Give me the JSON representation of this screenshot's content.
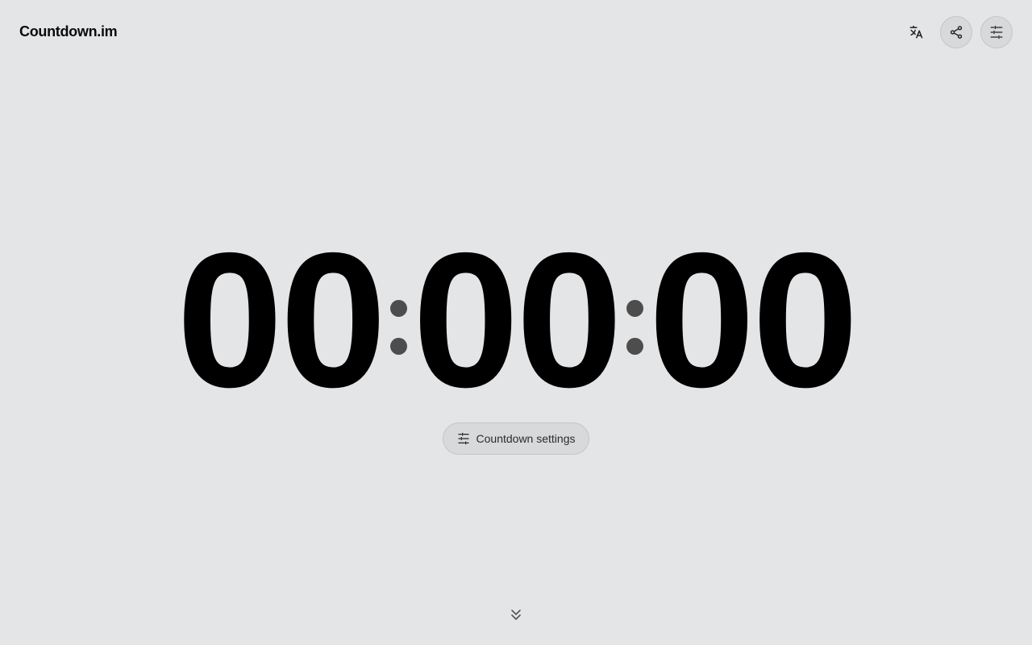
{
  "app": {
    "brand": "Countdown.im"
  },
  "header": {
    "actions": [
      {
        "name": "translate-icon"
      },
      {
        "name": "share-icon"
      },
      {
        "name": "sliders-icon"
      }
    ]
  },
  "timer": {
    "hours": "00",
    "minutes": "00",
    "seconds": "00"
  },
  "settings": {
    "label": "Countdown settings"
  },
  "colors": {
    "background": "#e4e5e7",
    "digits": "#000000",
    "separator": "#4d4d4d",
    "button_bg": "#d8d9db"
  }
}
